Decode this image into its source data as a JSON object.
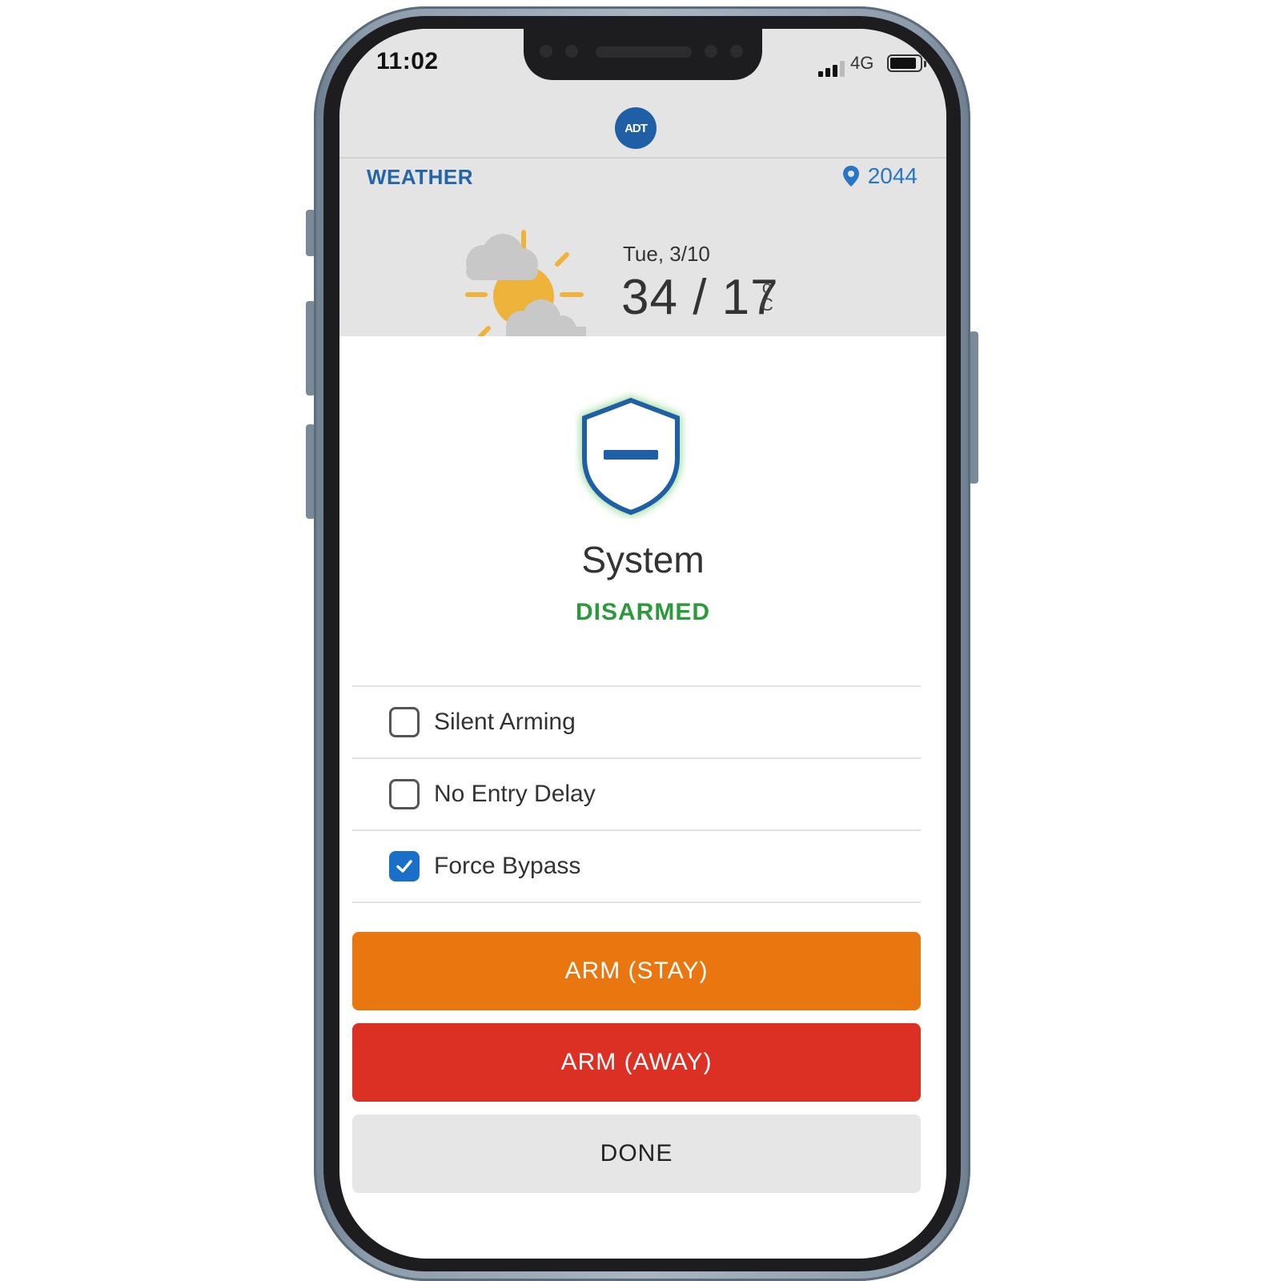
{
  "status_bar": {
    "time": "11:02",
    "network": "4G",
    "icons": [
      "signal-icon",
      "battery-icon"
    ]
  },
  "brand": {
    "logo_text": "ADT",
    "color": "#1f5fa6"
  },
  "weather": {
    "label": "WEATHER",
    "location": "2044",
    "date": "Tue, 3/10",
    "temperature": "34 / 17",
    "unit_degree": "o",
    "unit_scale": "C",
    "icon": "partly-sunny-icon"
  },
  "system": {
    "title": "System",
    "status": "DISARMED",
    "status_color": "#2a9a3a",
    "icon": "shield-disarmed-icon"
  },
  "options": [
    {
      "label": "Silent Arming",
      "checked": false
    },
    {
      "label": "No Entry Delay",
      "checked": false
    },
    {
      "label": "Force Bypass",
      "checked": true
    }
  ],
  "actions": {
    "arm_stay": "ARM (STAY)",
    "arm_away": "ARM (AWAY)",
    "done": "DONE"
  },
  "colors": {
    "accent": "#2464a8",
    "arm_stay": "#e9760f",
    "arm_away": "#dd3025",
    "checkbox_checked": "#1a6fc8"
  }
}
